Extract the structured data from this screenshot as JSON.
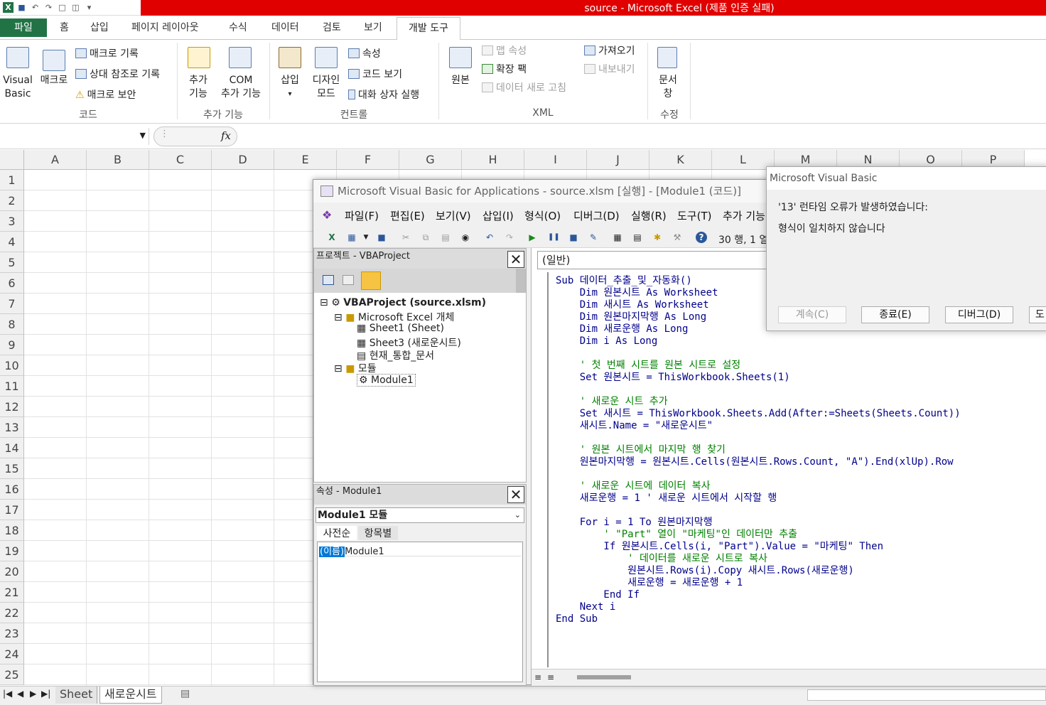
{
  "window": {
    "title": "source  -  Microsoft Excel (제품 인증 실패)"
  },
  "ribbon_tabs": {
    "file": "파일",
    "home": "홈",
    "insert": "삽입",
    "layout": "페이지 레이아웃",
    "formulas": "수식",
    "data": "데이터",
    "review": "검토",
    "view": "보기",
    "developer": "개발 도구"
  },
  "ribbon": {
    "code": {
      "visual_basic_1": "Visual",
      "visual_basic_2": "Basic",
      "macros": "매크로",
      "record": "매크로 기록",
      "relative": "상대 참조로 기록",
      "security": "매크로 보안",
      "label": "코드"
    },
    "addins": {
      "addins_1": "추가",
      "addins_2": "기능",
      "com_1": "COM",
      "com_2": "추가 기능",
      "label": "추가 기능"
    },
    "controls": {
      "insert": "삽입",
      "insert_arrow": "▾",
      "design_1": "디자인",
      "design_2": "모드",
      "properties": "속성",
      "view_code": "코드 보기",
      "run_dialog": "대화 상자 실행",
      "label": "컨트롤"
    },
    "xml": {
      "source": "원본",
      "map_props": "맵 속성",
      "expansion": "확장 팩",
      "refresh": "데이터 새로 고침",
      "import": "가져오기",
      "export": "내보내기",
      "label": "XML"
    },
    "modify": {
      "doc_1": "문서",
      "doc_2": "창",
      "label": "수정"
    }
  },
  "formula_bar": {
    "fx": "fx",
    "value": ""
  },
  "columns": [
    "A",
    "B",
    "C",
    "D",
    "E",
    "F",
    "G",
    "H",
    "I",
    "J",
    "K",
    "L",
    "M",
    "N",
    "O",
    "P"
  ],
  "rows": [
    "1",
    "2",
    "3",
    "4",
    "5",
    "6",
    "7",
    "8",
    "9",
    "10",
    "11",
    "12",
    "13",
    "14",
    "15",
    "16",
    "17",
    "18",
    "19",
    "20",
    "21",
    "22",
    "23",
    "24",
    "25"
  ],
  "sheet_tabs": [
    "Sheet",
    "새로운시트"
  ],
  "vbe": {
    "title": "Microsoft Visual Basic for Applications - source.xlsm [실행] - [Module1 (코드)]",
    "menu": [
      "파일(F)",
      "편집(E)",
      "보기(V)",
      "삽입(I)",
      "형식(O)",
      "디버그(D)",
      "실행(R)",
      "도구(T)",
      "추가 기능"
    ],
    "position": "30 행, 1 열",
    "project": {
      "title": "프로젝트 - VBAProject",
      "tree": {
        "root": "VBAProject (source.xlsm)",
        "excel_objects": "Microsoft Excel 개체",
        "sheet1": "Sheet1 (Sheet)",
        "sheet3": "Sheet3 (새로운시트)",
        "workbook": "현재_통합_문서",
        "modules": "모듈",
        "module1": "Module1"
      }
    },
    "properties": {
      "title": "속성 - Module1",
      "object": "Module1 모듈",
      "tab_alpha": "사전순",
      "tab_cat": "항목별",
      "name_key": "(이름)",
      "name_value": "Module1"
    },
    "code_combo": "(일반)",
    "code_lines": [
      {
        "t": "Sub 데이터_추출_및_자동화()",
        "c": "kw"
      },
      {
        "t": "    Dim 원본시트 As Worksheet",
        "c": "kw"
      },
      {
        "t": "    Dim 새시트 As Worksheet",
        "c": "kw"
      },
      {
        "t": "    Dim 원본마지막행 As Long",
        "c": "kw"
      },
      {
        "t": "    Dim 새로운행 As Long",
        "c": "kw"
      },
      {
        "t": "    Dim i As Long",
        "c": "kw"
      },
      {
        "t": "",
        "c": ""
      },
      {
        "t": "    ' 첫 번째 시트를 원본 시트로 설정",
        "c": "cm"
      },
      {
        "t": "    Set 원본시트 = ThisWorkbook.Sheets(1)",
        "c": "kw"
      },
      {
        "t": "",
        "c": ""
      },
      {
        "t": "    ' 새로운 시트 추가",
        "c": "cm"
      },
      {
        "t": "    Set 새시트 = ThisWorkbook.Sheets.Add(After:=Sheets(Sheets.Count))",
        "c": "kw"
      },
      {
        "t": "    새시트.Name = \"새로운시트\"",
        "c": "kw"
      },
      {
        "t": "",
        "c": ""
      },
      {
        "t": "    ' 원본 시트에서 마지막 행 찾기",
        "c": "cm"
      },
      {
        "t": "    원본마지막행 = 원본시트.Cells(원본시트.Rows.Count, \"A\").End(xlUp).Row",
        "c": "kw"
      },
      {
        "t": "",
        "c": ""
      },
      {
        "t": "    ' 새로운 시트에 데이터 복사",
        "c": "cm"
      },
      {
        "t": "    새로운행 = 1 ' 새로운 시트에서 시작할 행",
        "c": "mix"
      },
      {
        "t": "",
        "c": ""
      },
      {
        "t": "    For i = 1 To 원본마지막행",
        "c": "kw"
      },
      {
        "t": "        ' \"Part\" 열이 \"마케팅\"인 데이터만 추출",
        "c": "cm"
      },
      {
        "t": "        If 원본시트.Cells(i, \"Part\").Value = \"마케팅\" Then",
        "c": "kw"
      },
      {
        "t": "            ' 데이터를 새로운 시트로 복사",
        "c": "cm"
      },
      {
        "t": "            원본시트.Rows(i).Copy 새시트.Rows(새로운행)",
        "c": "kw"
      },
      {
        "t": "            새로운행 = 새로운행 + 1",
        "c": "kw"
      },
      {
        "t": "        End If",
        "c": "kw"
      },
      {
        "t": "    Next i",
        "c": "kw"
      },
      {
        "t": "End Sub",
        "c": "kw"
      }
    ]
  },
  "dialog": {
    "title": "Microsoft Visual Basic",
    "message1": "'13' 런타임 오류가 발생하였습니다:",
    "message2": "형식이 일치하지 않습니다",
    "btn_continue": "계속(C)",
    "btn_end": "종료(E)",
    "btn_debug": "디버그(D)",
    "btn_help": "도"
  }
}
